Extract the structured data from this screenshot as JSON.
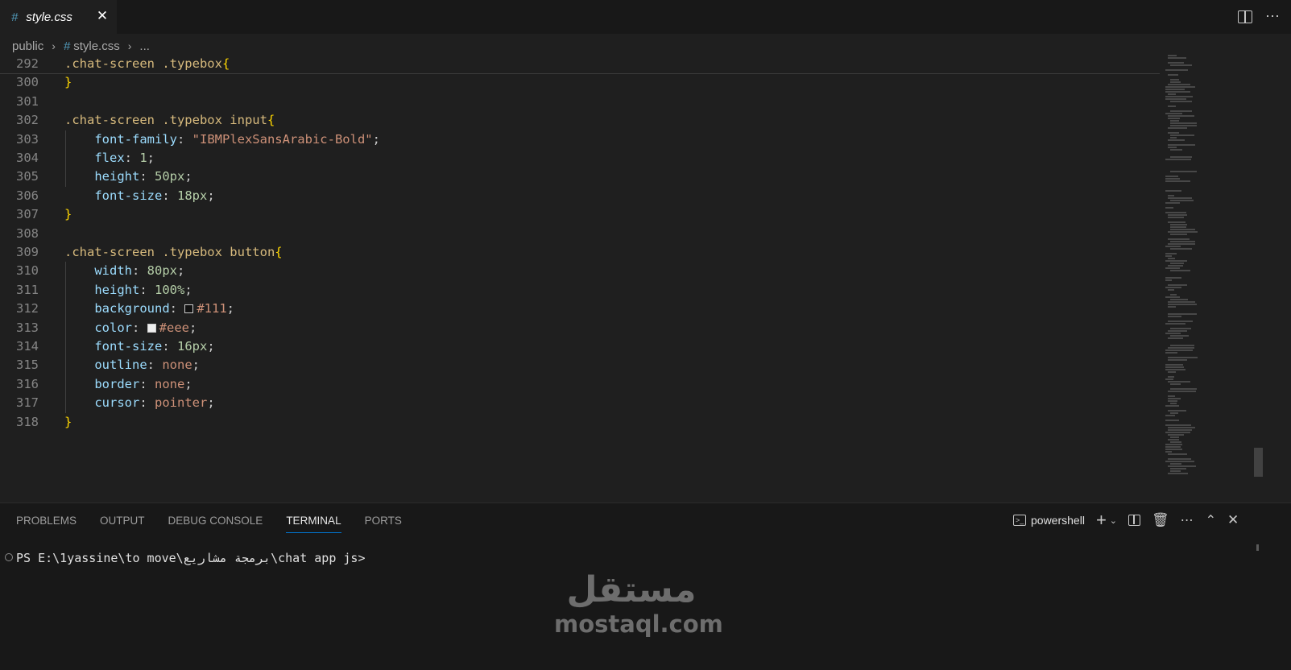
{
  "tab": {
    "icon": "css-hash-icon",
    "hash": "#",
    "label": "style.css",
    "close": "✕"
  },
  "breadcrumb": {
    "folder": "public",
    "hash": "#",
    "file": "style.css",
    "more": "..."
  },
  "editor": {
    "lines": [
      {
        "n": "292",
        "tokens": [
          {
            "c": "sel",
            "t": ".chat-screen .typebox"
          },
          {
            "c": "brace",
            "t": "{"
          }
        ]
      },
      {
        "n": "300",
        "tokens": [
          {
            "c": "brace",
            "t": "}"
          }
        ]
      },
      {
        "n": "301",
        "tokens": []
      },
      {
        "n": "302",
        "tokens": [
          {
            "c": "sel",
            "t": ".chat-screen .typebox input"
          },
          {
            "c": "brace",
            "t": "{"
          }
        ]
      },
      {
        "n": "303",
        "tokens": [
          {
            "c": "prop",
            "t": "    font-family"
          },
          {
            "c": "plain",
            "t": ": "
          },
          {
            "c": "str",
            "t": "\"IBMPlexSansArabic-Bold\""
          },
          {
            "c": "plain",
            "t": ";"
          }
        ]
      },
      {
        "n": "304",
        "tokens": [
          {
            "c": "prop",
            "t": "    flex"
          },
          {
            "c": "plain",
            "t": ": "
          },
          {
            "c": "num",
            "t": "1"
          },
          {
            "c": "plain",
            "t": ";"
          }
        ]
      },
      {
        "n": "305",
        "tokens": [
          {
            "c": "prop",
            "t": "    height"
          },
          {
            "c": "plain",
            "t": ": "
          },
          {
            "c": "num",
            "t": "50px"
          },
          {
            "c": "plain",
            "t": ";"
          }
        ]
      },
      {
        "n": "306",
        "tokens": [
          {
            "c": "prop",
            "t": "    font-size"
          },
          {
            "c": "plain",
            "t": ": "
          },
          {
            "c": "num",
            "t": "18px"
          },
          {
            "c": "plain",
            "t": ";"
          }
        ]
      },
      {
        "n": "307",
        "tokens": [
          {
            "c": "brace",
            "t": "}"
          }
        ]
      },
      {
        "n": "308",
        "tokens": []
      },
      {
        "n": "309",
        "tokens": [
          {
            "c": "sel",
            "t": ".chat-screen .typebox button"
          },
          {
            "c": "brace",
            "t": "{"
          }
        ]
      },
      {
        "n": "310",
        "tokens": [
          {
            "c": "prop",
            "t": "    width"
          },
          {
            "c": "plain",
            "t": ": "
          },
          {
            "c": "num",
            "t": "80px"
          },
          {
            "c": "plain",
            "t": ";"
          }
        ]
      },
      {
        "n": "311",
        "tokens": [
          {
            "c": "prop",
            "t": "    height"
          },
          {
            "c": "plain",
            "t": ": "
          },
          {
            "c": "num",
            "t": "100%"
          },
          {
            "c": "plain",
            "t": ";"
          }
        ]
      },
      {
        "n": "312",
        "tokens": [
          {
            "c": "prop",
            "t": "    background"
          },
          {
            "c": "plain",
            "t": ": "
          },
          {
            "swatch": "#111111"
          },
          {
            "c": "str",
            "t": "#111"
          },
          {
            "c": "plain",
            "t": ";"
          }
        ]
      },
      {
        "n": "313",
        "tokens": [
          {
            "c": "prop",
            "t": "    color"
          },
          {
            "c": "plain",
            "t": ": "
          },
          {
            "swatch": "#eeeeee"
          },
          {
            "c": "str",
            "t": "#eee"
          },
          {
            "c": "plain",
            "t": ";"
          }
        ]
      },
      {
        "n": "314",
        "tokens": [
          {
            "c": "prop",
            "t": "    font-size"
          },
          {
            "c": "plain",
            "t": ": "
          },
          {
            "c": "num",
            "t": "16px"
          },
          {
            "c": "plain",
            "t": ";"
          }
        ]
      },
      {
        "n": "315",
        "tokens": [
          {
            "c": "prop",
            "t": "    outline"
          },
          {
            "c": "plain",
            "t": ": "
          },
          {
            "c": "str",
            "t": "none"
          },
          {
            "c": "plain",
            "t": ";"
          }
        ]
      },
      {
        "n": "316",
        "tokens": [
          {
            "c": "prop",
            "t": "    border"
          },
          {
            "c": "plain",
            "t": ": "
          },
          {
            "c": "str",
            "t": "none"
          },
          {
            "c": "plain",
            "t": ";"
          }
        ]
      },
      {
        "n": "317",
        "tokens": [
          {
            "c": "prop",
            "t": "    cursor"
          },
          {
            "c": "plain",
            "t": ": "
          },
          {
            "c": "str",
            "t": "pointer"
          },
          {
            "c": "plain",
            "t": ";"
          }
        ]
      },
      {
        "n": "318",
        "tokens": [
          {
            "c": "brace",
            "t": "}"
          }
        ]
      }
    ]
  },
  "panel": {
    "tabs": [
      "PROBLEMS",
      "OUTPUT",
      "DEBUG CONSOLE",
      "TERMINAL",
      "PORTS"
    ],
    "active_tab": "TERMINAL",
    "terminal_name": "powershell",
    "icons": [
      "terminal-icon",
      "plus-icon",
      "chevron-down-icon",
      "split-terminal-icon",
      "trash-icon",
      "more-icon",
      "chevron-up-icon",
      "close-icon"
    ]
  },
  "terminal": {
    "prompt": "PS E:\\1yassine\\to move\\برمجة مشاريع\\chat app js>"
  },
  "watermark": {
    "arabic": "مستقل",
    "latin": "mostaql.com"
  },
  "colors": {
    "selector": "#d7ba7d",
    "brace": "#ffd700",
    "property": "#9cdcfe",
    "number": "#b5cea8",
    "string": "#ce9178",
    "accent": "#0078d4"
  }
}
